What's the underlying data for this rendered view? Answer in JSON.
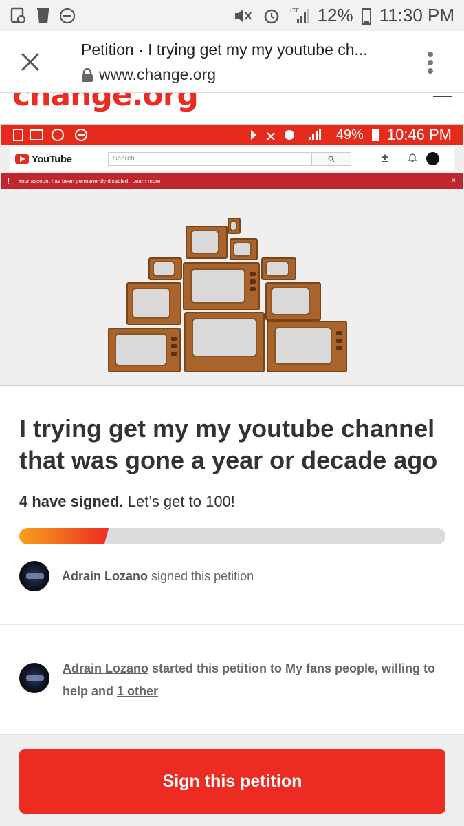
{
  "status_bar": {
    "battery_percent": "12%",
    "time": "11:30 PM",
    "network_label": "LTE",
    "icons_left": [
      "notification-icon",
      "trash-icon",
      "dnd-icon"
    ],
    "icons_right": [
      "mute-icon",
      "alarm-icon",
      "signal-icon",
      "battery-icon"
    ]
  },
  "browser": {
    "tab_title": "Petition · I trying get my my youtube ch...",
    "url": "www.change.org"
  },
  "site": {
    "logo_text": "change.org",
    "brand_color": "#ec2c22"
  },
  "petition_image": {
    "inner_status": {
      "battery_percent": "49%",
      "time": "10:46 PM"
    },
    "youtube": {
      "logo_text": "YouTube",
      "search_placeholder": "Search",
      "alert_text": "Your account has been permanently disabled.",
      "alert_link": "Learn more",
      "alert_close": "×"
    }
  },
  "petition": {
    "title": "I trying get my my youtube channel that was gone a year or decade ago",
    "signed_count_text": "4 have signed.",
    "goal_text": "Let’s get to 100!",
    "progress_fraction": 0.21,
    "recent_signer": {
      "name": "Adrain Lozano",
      "action": "signed this petition"
    },
    "starter": {
      "name": "Adrain Lozano",
      "text_mid": "started this petition to My fans people, willing to help and",
      "other_link": "1 other"
    },
    "sign_button_label": "Sign this petition"
  }
}
